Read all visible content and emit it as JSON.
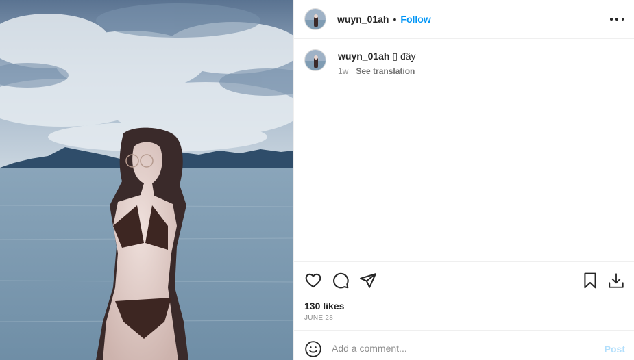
{
  "post": {
    "username": "wuyn_01ah",
    "separator": "•",
    "follow_label": "Follow",
    "more_icon": "more-horizontal-icon",
    "photo_alt": "photo"
  },
  "caption": {
    "username": "wuyn_01ah",
    "text": "▯ đây",
    "age": "1w",
    "see_translation": "See translation"
  },
  "actions": {
    "like_icon": "heart-icon",
    "comment_icon": "comment-icon",
    "share_icon": "share-icon",
    "save_icon": "bookmark-icon",
    "download_icon": "download-icon",
    "likes": "130 likes",
    "date": "June 28"
  },
  "comment_box": {
    "emoji_icon": "emoji-icon",
    "placeholder": "Add a comment...",
    "post_label": "Post"
  },
  "colors": {
    "accent": "#0095f6",
    "post_disabled": "#b2dffc",
    "muted": "#8e8e8e"
  }
}
